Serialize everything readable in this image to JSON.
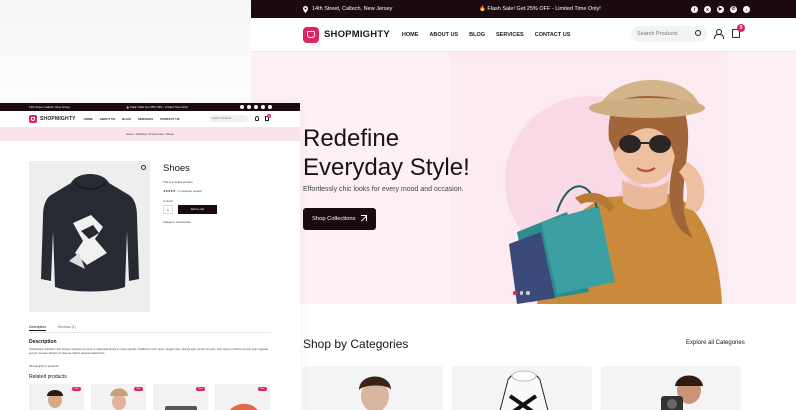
{
  "desktop": {
    "topbar": {
      "location": "14th Street, Caltech, New Jersey",
      "promo": "🔥 Flash Sale! Get 25% OFF - Limited Time Only!",
      "social": [
        "facebook-icon",
        "x-icon",
        "youtube-icon",
        "whatsapp-icon",
        "tiktok-icon"
      ]
    },
    "header": {
      "brand": "SHOPMIGHTY",
      "nav": [
        "HOME",
        "ABOUT US",
        "BLOG",
        "SERVICES",
        "CONTACT US"
      ],
      "search_placeholder": "Search Products",
      "cart_count": "0"
    },
    "hero": {
      "title_line1": "Redefine",
      "title_line2": "Everyday Style!",
      "subtitle": "Effortlessly chic looks for every mood and occasion.",
      "cta": "Shop Collections"
    },
    "categories": {
      "title": "Shop by Categories",
      "link": "Explore all Categories"
    },
    "colors": {
      "accent": "#e0245e",
      "dark": "#1b0a12",
      "hero_bg": "#fdf1f5"
    }
  },
  "product_page": {
    "topbar": {
      "location": "14th Street, Caltech, New Jersey",
      "promo": "🔥 Flash Sale! Get 25% OFF - Limited Time Only!"
    },
    "header": {
      "brand": "SHOPMIGHTY",
      "nav": [
        "HOME",
        "ABOUT US",
        "BLOG",
        "SERVICES",
        "CONTACT US"
      ],
      "search_placeholder": "Search Products",
      "cart_count": "0"
    },
    "breadcrumb": "Home / Clothing / Accessories / Shoes",
    "product": {
      "title": "Shoes",
      "short": "This is a simple product.",
      "stars": "★★★★★",
      "reviews": "(1 customer review)",
      "stock": "In stock",
      "qty": "1",
      "add_to_cart": "Add to cart",
      "category": "Category: Accessories"
    },
    "tabs": [
      "Description",
      "Reviews (1)"
    ],
    "description_heading": "Description",
    "description": "Pellentesque habitant morbi tristique senectus et netus et malesuada fames ac turpis egestas. Vestibulum tortor quam, feugiat vitae, ultricies eget, tempor sit amet, ante. Donec eu libero sit amet quam egestas semper. Aenean ultricies mi vitae est. Mauris placerat eleifend leo.",
    "photo_credit": "Photography by apostrofa",
    "related_heading": "Related products",
    "sale_badge": "Sale!"
  }
}
